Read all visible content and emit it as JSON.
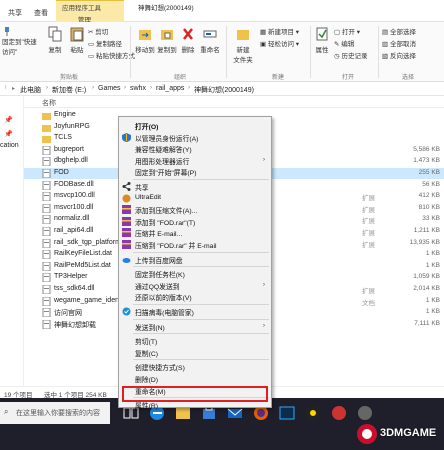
{
  "ribbon": {
    "tabs": [
      "共享",
      "查看",
      "管理"
    ],
    "context_group": "应用程序工具",
    "window_title": "神舞幻想(2000149)",
    "clipboard": {
      "pin": "固定到\"快速访问\"",
      "copy": "复制",
      "paste": "粘贴",
      "cut": "剪切",
      "copy_path": "复制路径",
      "paste_shortcut": "粘贴快捷方式",
      "label": "剪贴板"
    },
    "organize": {
      "move_to": "移动到",
      "copy_to": "复制到",
      "delete": "删除",
      "rename": "重命名",
      "label": "组织"
    },
    "new": {
      "new_folder": "新建\n文件夹",
      "new_item": "新建项目",
      "easy_access": "轻松访问",
      "label": "新建"
    },
    "open": {
      "properties": "属性",
      "open": "打开",
      "edit": "编辑",
      "history": "历史记录",
      "label": "打开"
    },
    "select": {
      "select_all": "全部选择",
      "select_none": "全部取消",
      "invert": "反向选择",
      "label": "选择"
    }
  },
  "address": {
    "crumbs": [
      "此电脑",
      "新加卷 (E:)",
      "Games",
      "swhx",
      "rail_apps",
      "神舞幻想(2000149)"
    ]
  },
  "nav_pane": {
    "items": [
      "cation"
    ]
  },
  "columns": {
    "name": "名称"
  },
  "files": [
    {
      "name": "Engine",
      "type": "",
      "size": ""
    },
    {
      "name": "JoyfunRPG",
      "type": "",
      "size": ""
    },
    {
      "name": "TCLS",
      "type": "",
      "size": ""
    },
    {
      "name": "bugreport",
      "type": "",
      "size": "5,586 KB"
    },
    {
      "name": "dbghelp.dll",
      "type": "",
      "size": "1,473 KB"
    },
    {
      "name": "FOD",
      "type": "",
      "size": "255 KB"
    },
    {
      "name": "FODBase.dll",
      "type": "",
      "size": "56 KB"
    },
    {
      "name": "msvcp100.dll",
      "type": "扩展",
      "size": "412 KB"
    },
    {
      "name": "msvcr100.dll",
      "type": "扩展",
      "size": "810 KB"
    },
    {
      "name": "normaliz.dll",
      "type": "扩展",
      "size": "33 KB"
    },
    {
      "name": "rail_api64.dll",
      "type": "扩展",
      "size": "1,211 KB"
    },
    {
      "name": "rail_sdk_tgp_platform64.",
      "type": "扩展",
      "size": "13,935 KB"
    },
    {
      "name": "RailKeyFileList.dat",
      "type": "",
      "size": "1 KB"
    },
    {
      "name": "RailPeMd5List.dat",
      "type": "",
      "size": "1 KB"
    },
    {
      "name": "TP3Helper",
      "type": "",
      "size": "1,059 KB"
    },
    {
      "name": "tss_sdk64.dll",
      "type": "扩展",
      "size": "2,014 KB"
    },
    {
      "name": "wegame_game_identify_",
      "type": "文档",
      "size": "1 KB"
    },
    {
      "name": "访问官网",
      "type": "",
      "size": "1 KB"
    },
    {
      "name": "神舞幻想卸载",
      "type": "",
      "size": "7,111 KB"
    }
  ],
  "status": {
    "count": "19 个项目",
    "selected": "选中 1 个项目  254 KB"
  },
  "taskbar": {
    "search_placeholder": "在这里输入你要搜索的内容"
  },
  "context_menu": {
    "items": [
      {
        "label": "打开(O)",
        "bold": true,
        "icon": "none",
        "arrow": false
      },
      {
        "label": "以管理员身份运行(A)",
        "icon": "shield-icon",
        "arrow": false
      },
      {
        "label": "兼容性疑难解答(Y)",
        "icon": "none",
        "arrow": false
      },
      {
        "label": "用图形处理器运行",
        "icon": "none",
        "arrow": true
      },
      {
        "label": "固定到\"开始\"屏幕(P)",
        "icon": "none",
        "arrow": false
      },
      {
        "label": "共享",
        "icon": "share-icon",
        "arrow": false
      },
      {
        "label": "UltraEdit",
        "icon": "ultraedit-icon",
        "arrow": false
      },
      {
        "label": "添加到压缩文件(A)...",
        "icon": "archive-icon",
        "arrow": false
      },
      {
        "label": "添加到 \"FOD.rar\"(T)",
        "icon": "archive-icon",
        "arrow": false
      },
      {
        "label": "压缩并 E-mail...",
        "icon": "archive-icon",
        "arrow": false
      },
      {
        "label": "压缩到 \"FOD.rar\" 并 E-mail",
        "icon": "archive-icon",
        "arrow": false
      },
      {
        "label": "上传到百度网盘",
        "icon": "cloud-icon",
        "arrow": false
      },
      {
        "label": "固定到任务栏(K)",
        "icon": "none",
        "arrow": false
      },
      {
        "label": "通过QQ发送到",
        "icon": "none",
        "arrow": true
      },
      {
        "label": "还原以前的版本(V)",
        "icon": "none",
        "arrow": false
      },
      {
        "label": "扫描病毒(电脑管家)",
        "icon": "scan-icon",
        "arrow": false
      },
      {
        "label": "发送到(N)",
        "icon": "none",
        "arrow": true
      },
      {
        "label": "剪切(T)",
        "icon": "none",
        "arrow": false
      },
      {
        "label": "复制(C)",
        "icon": "none",
        "arrow": false
      },
      {
        "label": "创建快捷方式(S)",
        "icon": "none",
        "arrow": false
      },
      {
        "label": "删除(D)",
        "icon": "none",
        "arrow": false
      },
      {
        "label": "重命名(M)",
        "icon": "none",
        "arrow": false
      },
      {
        "label": "属性(R)",
        "icon": "none",
        "arrow": false
      }
    ]
  },
  "watermark": {
    "text": "3DMGAME"
  },
  "colors": {
    "selection": "#cce8ff",
    "highlight_box": "#e02020",
    "context_tab": "#fbe9a8",
    "taskbar": "#1f1f2b"
  }
}
